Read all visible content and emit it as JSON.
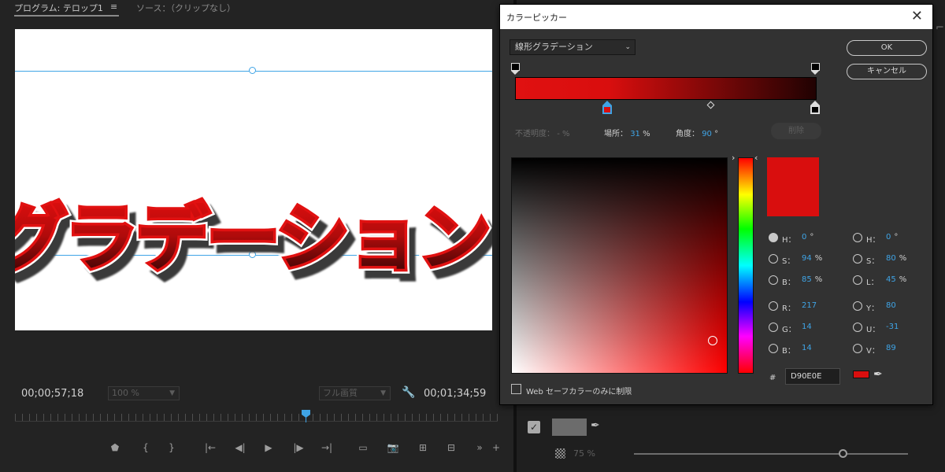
{
  "monitor": {
    "tab_program": "プログラム: テロップ1",
    "tab_menu": "≡",
    "tab_source": "ソース：（クリップなし）",
    "canvas_text": "グラデーション",
    "timecode_left": "00;00;57;18",
    "timecode_right": "00;01;34;59",
    "zoom": "100 %",
    "quality": "フル画質"
  },
  "effects_panel": {
    "opacity": "75 %"
  },
  "color_picker": {
    "title": "カラーピッカー",
    "fill_type": "線形グラデーション",
    "ok_label": "OK",
    "cancel_label": "キャンセル",
    "opacity_label": "不透明度：",
    "opacity_value": "- %",
    "location_label": "場所：",
    "location_value": "31",
    "location_unit": "%",
    "angle_label": "角度：",
    "angle_value": "90",
    "angle_unit": "°",
    "delete_label": "削除",
    "preview_color": "#D90E0E",
    "hsb": [
      {
        "label": "H：",
        "value": "0",
        "unit": "°",
        "selected": true
      },
      {
        "label": "S：",
        "value": "94",
        "unit": "%",
        "selected": false
      },
      {
        "label": "B：",
        "value": "85",
        "unit": "%",
        "selected": false
      }
    ],
    "rgb": [
      {
        "label": "R：",
        "value": "217"
      },
      {
        "label": "G：",
        "value": "14"
      },
      {
        "label": "B：",
        "value": "14"
      }
    ],
    "hsl": [
      {
        "label": "H：",
        "value": "0",
        "unit": "°"
      },
      {
        "label": "S：",
        "value": "80",
        "unit": "%"
      },
      {
        "label": "L：",
        "value": "45",
        "unit": "%"
      }
    ],
    "yuv": [
      {
        "label": "Y：",
        "value": "80"
      },
      {
        "label": "U：",
        "value": "-31"
      },
      {
        "label": "V：",
        "value": "89"
      }
    ],
    "hex_hash": "#",
    "hex_value": "D90E0E",
    "websafe_label": "Web セーフカラーのみに制限"
  },
  "colors": {
    "accent": "#3FA4E6",
    "gradient_start": "#D90E0E",
    "gradient_end": "#200202"
  }
}
